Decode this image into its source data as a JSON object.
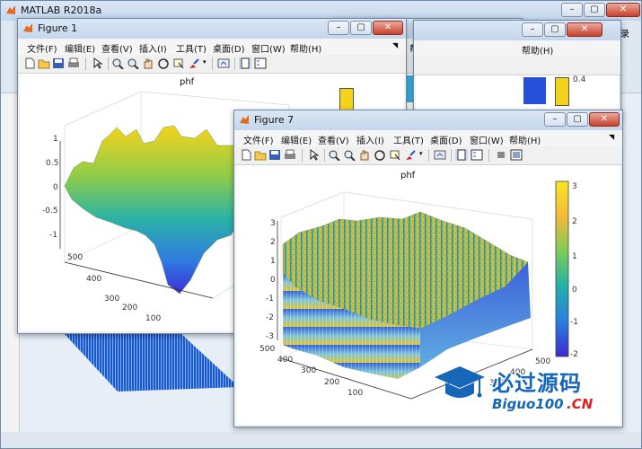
{
  "matlab": {
    "title": "MATLAB R2018a"
  },
  "menus": {
    "file": "文件(F)",
    "edit": "编辑(E)",
    "view": "查看(V)",
    "insert": "插入(I)",
    "tools": "工具(T)",
    "desktop": "桌面(D)",
    "window": "窗口(W)",
    "help": "帮助(H)"
  },
  "back_windows": {
    "help": "帮助(H)",
    "colorbar_value": "0.4",
    "right_text": "录"
  },
  "figure1": {
    "title": "Figure 1",
    "plot_title": "phf",
    "z_ticks": [
      "1",
      "0.5",
      "0",
      "-0.5",
      "-1"
    ],
    "y_ticks": [
      "500",
      "400",
      "300",
      "200",
      "100"
    ]
  },
  "figure7": {
    "title": "Figure 7",
    "plot_title": "phf",
    "z_ticks": [
      "3",
      "2",
      "1",
      "0",
      "-1",
      "-2",
      "-3"
    ],
    "y_ticks": [
      "500",
      "400",
      "300",
      "200",
      "100"
    ],
    "x_ticks": [
      "500",
      "400",
      "300"
    ],
    "colorbar_ticks": [
      "3",
      "2",
      "1",
      "0",
      "-1",
      "-2"
    ]
  },
  "watermark": {
    "text": "必过源码",
    "sub": "Biguo100",
    "domain": ".CN"
  },
  "colors": {
    "title_bar": "#c4d6ec",
    "close_button": "#c8412c",
    "watermark_blue": "#1767b8",
    "watermark_red": "#e02020"
  }
}
